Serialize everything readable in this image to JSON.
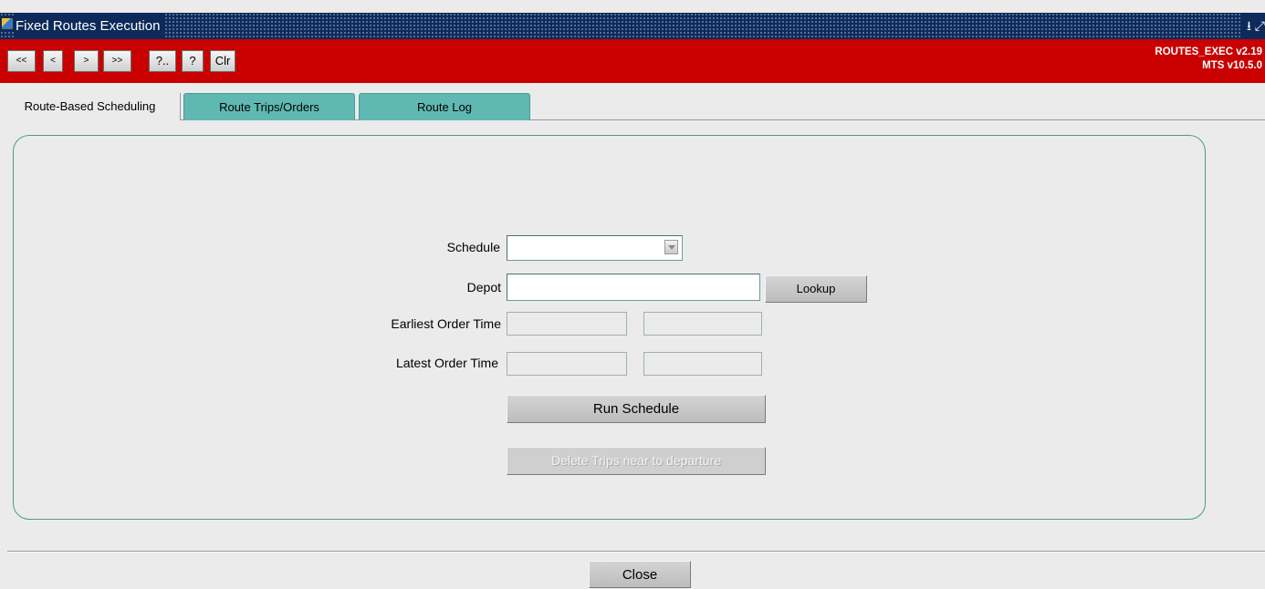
{
  "window": {
    "title": "Fixed Routes Execution",
    "controls": "⭳ ⤢"
  },
  "toolbar": {
    "buttons": [
      {
        "id": "first",
        "label": "<<"
      },
      {
        "id": "prev",
        "label": "<"
      },
      {
        "id": "next",
        "label": ">"
      },
      {
        "id": "last",
        "label": ">>"
      },
      {
        "id": "help-list",
        "label": "?.."
      },
      {
        "id": "help",
        "label": "?"
      },
      {
        "id": "clear",
        "label": "Clr"
      }
    ],
    "version_line1": "ROUTES_EXEC v2.19",
    "version_line2": "MTS v10.5.0"
  },
  "tabs": [
    {
      "label": "Route-Based Scheduling",
      "active": true
    },
    {
      "label": "Route Trips/Orders",
      "active": false
    },
    {
      "label": "Route Log",
      "active": false
    }
  ],
  "form": {
    "schedule_label": "Schedule",
    "schedule_value": "",
    "depot_label": "Depot",
    "depot_value": "",
    "lookup_label": "Lookup",
    "earliest_label": "Earliest Order Time",
    "earliest_date": "",
    "earliest_time": "",
    "latest_label": "Latest Order Time",
    "latest_date": "",
    "latest_time": "",
    "run_label": "Run Schedule",
    "delete_label": "Delete Trips near to departure"
  },
  "footer": {
    "close_label": "Close"
  }
}
